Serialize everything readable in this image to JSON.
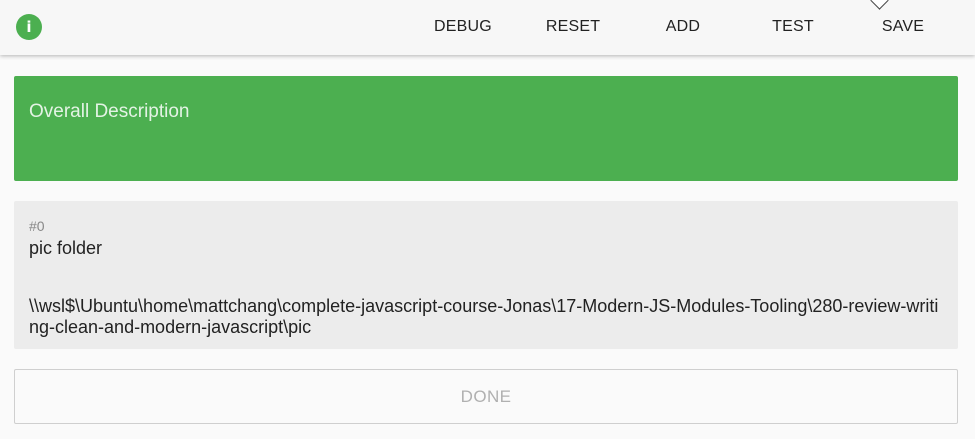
{
  "toolbar": {
    "info_icon": "i",
    "buttons": {
      "debug": "DEBUG",
      "reset": "RESET",
      "add": "ADD",
      "test": "TEST",
      "save": "SAVE"
    }
  },
  "description": {
    "label": "Overall Description"
  },
  "items": [
    {
      "index": "#0",
      "title": "pic folder",
      "path": "\\\\wsl$\\Ubuntu\\home\\mattchang\\complete-javascript-course-Jonas\\17-Modern-JS-Modules-Tooling\\280-review-writing-clean-and-modern-javascript\\pic"
    }
  ],
  "footer": {
    "done_label": "DONE"
  },
  "colors": {
    "accent": "#4caf50",
    "card_bg": "#ececec"
  }
}
